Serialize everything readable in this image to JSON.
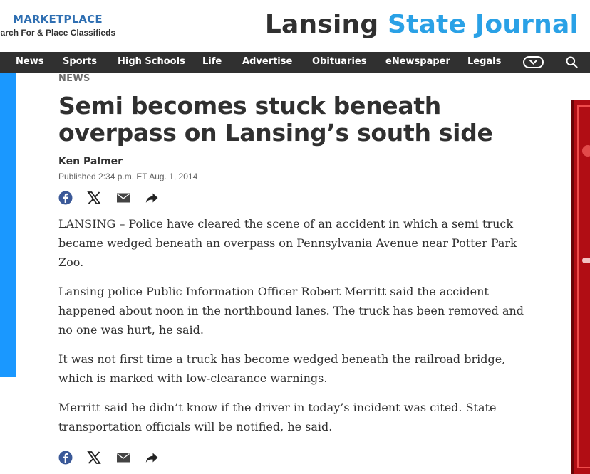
{
  "header": {
    "marketplace_title": "MARKETPLACE",
    "marketplace_subtitle": "earch For & Place Classifieds",
    "logo_part1": "Lansing",
    "logo_part2": "State Journal"
  },
  "nav": {
    "items": [
      "News",
      "Sports",
      "High Schools",
      "Life",
      "Advertise",
      "Obituaries",
      "eNewspaper",
      "Legals"
    ],
    "more_icon": "chevron-down-icon",
    "search_icon": "search-icon"
  },
  "article": {
    "section": "NEWS",
    "headline": "Semi becomes stuck beneath overpass on Lansing’s south side",
    "author": "Ken Palmer",
    "published": "Published 2:34 p.m. ET Aug. 1, 2014",
    "paragraphs": [
      "LANSING – Police have cleared the scene of an accident in which a semi truck became wedged beneath an overpass on Pennsylvania Avenue near Potter Park Zoo.",
      "Lansing police Public Information Officer Robert Merritt said the accident happened about noon in the northbound lanes. The truck has been removed and no one was hurt, he said.",
      "It was not first time a truck has become wedged beneath the railroad bridge, which is marked with low-clearance warnings.",
      "Merritt said he didn’t know if the driver in today’s incident was cited. State transportation officials will be notified, he said."
    ],
    "share_icons": [
      "facebook-icon",
      "x-icon",
      "email-icon",
      "share-icon"
    ]
  },
  "colors": {
    "brand_blue": "#2aa1e6",
    "nav_bg": "#303030",
    "left_bar": "#1a98ff",
    "ad_red": "#b10d14"
  }
}
